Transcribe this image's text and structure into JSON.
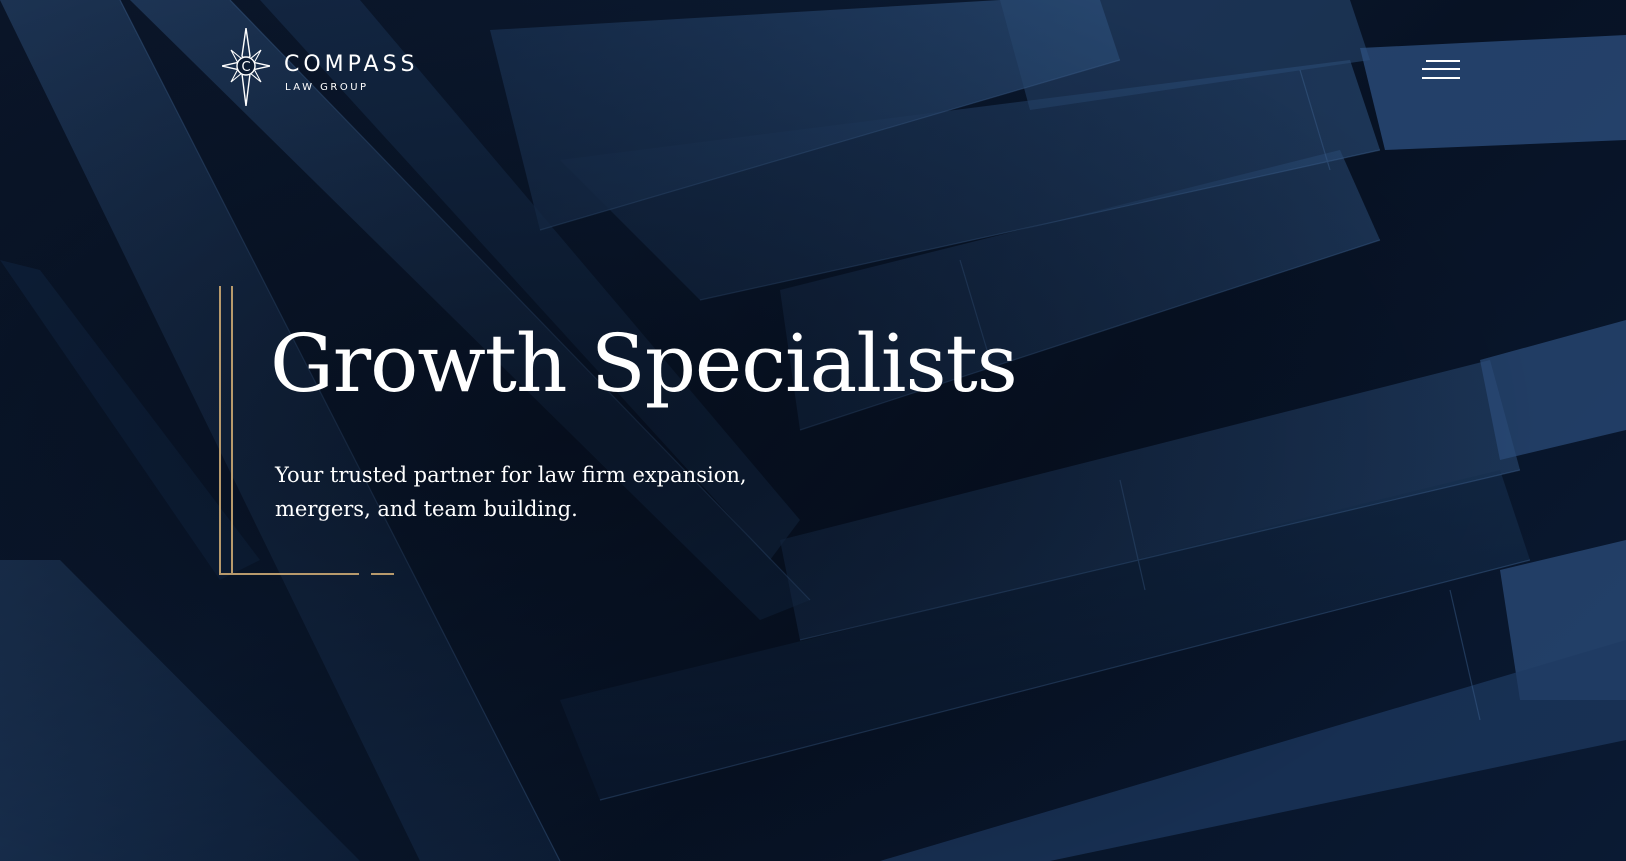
{
  "brand": {
    "name": "COMPASS",
    "tagline": "LAW GROUP",
    "mark_letter": "C",
    "icon": "compass-star-icon"
  },
  "nav": {
    "menu_icon": "hamburger-menu-icon"
  },
  "hero": {
    "title": "Growth Specialists",
    "subtitle": "Your trusted partner for law firm expansion, mergers, and team building."
  },
  "colors": {
    "background": "#0a1528",
    "accent_gold": "#b89a6c",
    "text": "#ffffff",
    "panel_blue": "#1f3a5e"
  }
}
